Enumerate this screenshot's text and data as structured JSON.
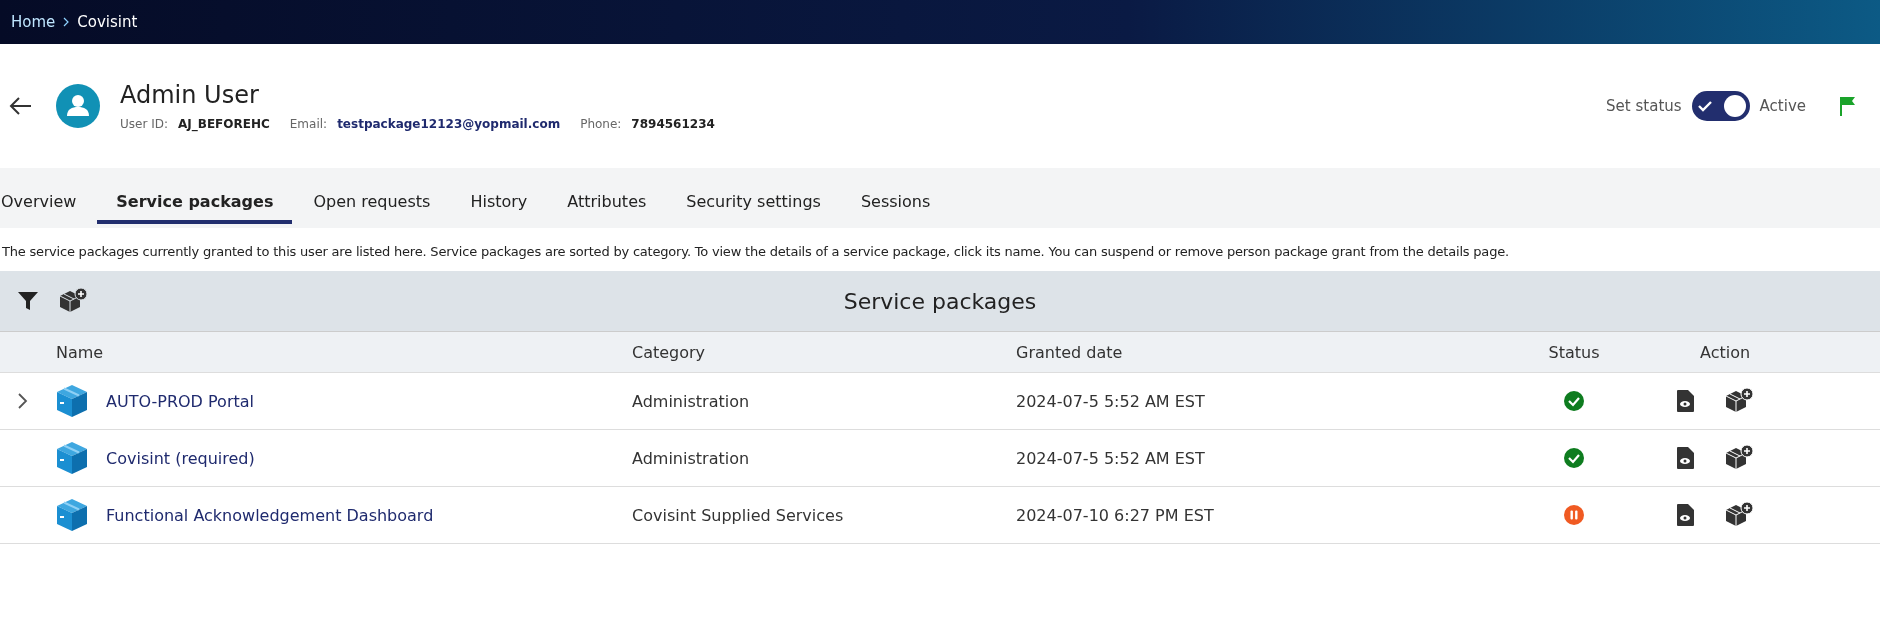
{
  "breadcrumb": [
    {
      "label": "Home",
      "link": true
    },
    {
      "label": "Covisint",
      "link": false
    }
  ],
  "user": {
    "name": "Admin User",
    "fields": [
      {
        "label": "User ID:",
        "value": "AJ_BEFOREHC",
        "kind": "plain"
      },
      {
        "label": "Email:",
        "value": "testpackage12123@yopmail.com",
        "kind": "link"
      },
      {
        "label": "Phone:",
        "value": "7894561234",
        "kind": "plain"
      }
    ]
  },
  "status": {
    "label": "Set status",
    "on": true,
    "value": "Active"
  },
  "tabs": [
    {
      "label": "Overview",
      "selected": false
    },
    {
      "label": "Service packages",
      "selected": true
    },
    {
      "label": "Open requests",
      "selected": false
    },
    {
      "label": "History",
      "selected": false
    },
    {
      "label": "Attributes",
      "selected": false
    },
    {
      "label": "Security settings",
      "selected": false
    },
    {
      "label": "Sessions",
      "selected": false
    }
  ],
  "description": "The service packages currently granted to this user are listed here. Service packages are sorted by category. To view the details of a service package, click its name. You can suspend or remove person package grant from the details page.",
  "table": {
    "title": "Service packages",
    "columns": [
      "Name",
      "Category",
      "Granted date",
      "Status",
      "Action"
    ],
    "rows": [
      {
        "name": "AUTO-PROD Portal",
        "category": "Administration",
        "granted": "2024-07-5 5:52 AM EST",
        "kind": "active",
        "expandable": true
      },
      {
        "name": "Covisint (required)",
        "category": "Administration",
        "granted": "2024-07-5 5:52 AM EST",
        "kind": "active",
        "expandable": false
      },
      {
        "name": "Functional Acknowledgement Dashboard",
        "category": "Covisint Supplied Services",
        "granted": "2024-07-10 6:27 PM EST",
        "kind": "suspended",
        "expandable": false
      }
    ]
  }
}
